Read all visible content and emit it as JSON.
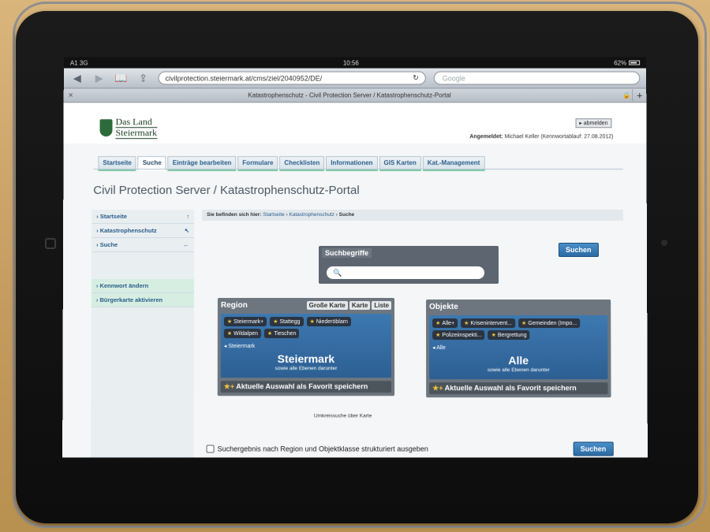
{
  "status": {
    "carrier": "A1",
    "network": "3G",
    "time": "10:56",
    "battery": "62%"
  },
  "browser": {
    "url": "civilprotection.steiermark.at/cms/ziel/2040952/DE/",
    "search_placeholder": "Google",
    "tab_title": "Katastrophenschutz - Civil Protection Server / Katastrophenschutz-Portal"
  },
  "header": {
    "logo_line1": "Das Land",
    "logo_line2": "Steiermark",
    "logout": "abmelden",
    "logged_in_label": "Angemeldet:",
    "logged_in_value": "Michael Keller (Kennwortablauf: 27.08.2012)"
  },
  "nav": [
    "Startseite",
    "Suche",
    "Einträge bearbeiten",
    "Formulare",
    "Checklisten",
    "Informationen",
    "GIS Karten",
    "Kat.-Management"
  ],
  "portal_title": "Civil Protection Server / Katastrophenschutz-Portal",
  "sidebar": {
    "items": [
      "Startseite",
      "Katastrophenschutz",
      "Suche"
    ],
    "actions": [
      "Kennwort ändern",
      "Bürgerkarte aktivieren"
    ]
  },
  "breadcrumb": {
    "prefix": "Sie befinden sich hier:",
    "items": [
      "Startseite",
      "Katastrophenschutz",
      "Suche"
    ]
  },
  "search": {
    "label": "Suchbegriffe",
    "button": "Suchen"
  },
  "region": {
    "title": "Region",
    "buttons": [
      "Große Karte",
      "Karte",
      "Liste"
    ],
    "chips": [
      "Steiermark+",
      "Stattegg",
      "Niederöblarn",
      "Wildalpen",
      "Tieschen"
    ],
    "back": "Steiermark",
    "selected": "Steiermark",
    "selected_sub": "sowie alle Ebenen darunter",
    "fav": "Aktuelle Auswahl als Favorit speichern",
    "umkreis": "Umkreissuche über Karte"
  },
  "objects": {
    "title": "Objekte",
    "chips": [
      "Alle+",
      "Krisenintervent...",
      "Gemeinden (Impo...",
      "Polizeiinspekti...",
      "Bergrettung"
    ],
    "back": "Alle",
    "selected": "Alle",
    "selected_sub": "sowie alle Ebenen darunter",
    "fav": "Aktuelle Auswahl als Favorit speichern"
  },
  "structured_label": "Suchergebnis nach Region und Objektklasse strukturiert ausgeben",
  "bottom_button": "Suchen"
}
